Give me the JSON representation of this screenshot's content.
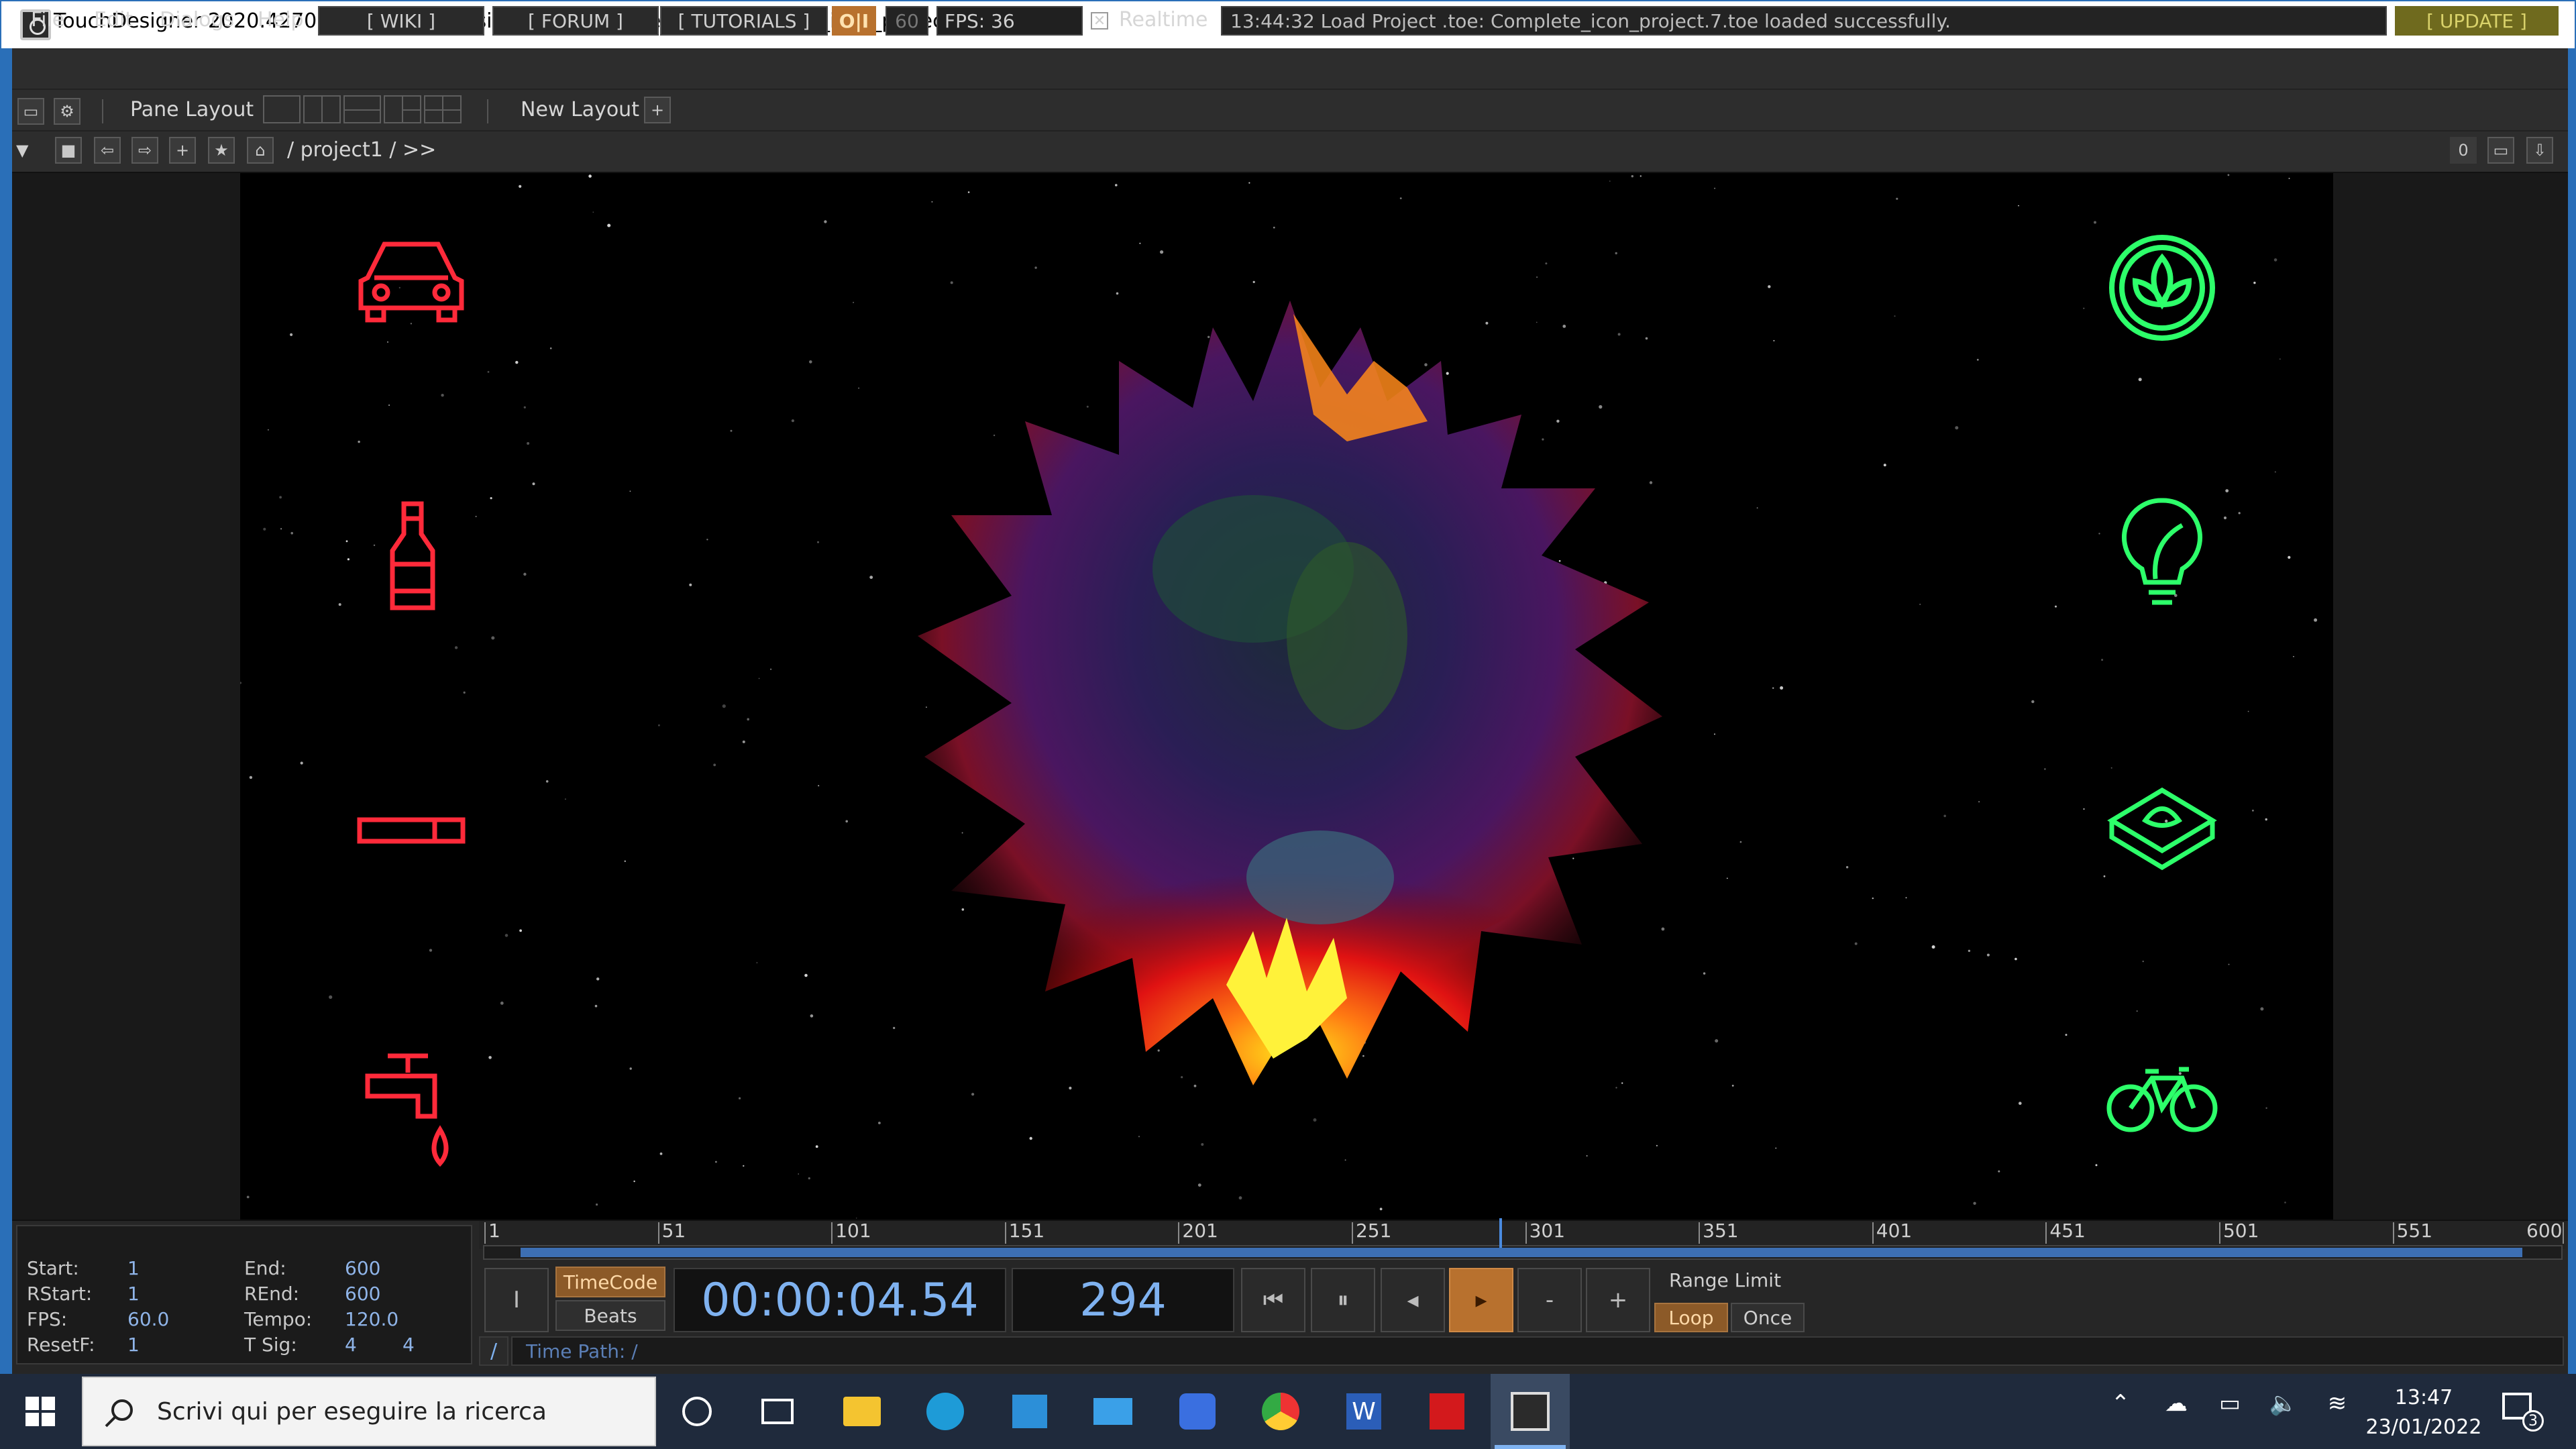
{
  "window": {
    "title": "TouchDesigner 2020.42700: C:/Users/massimo.cicognani/Desktop/Complete_icon_project.7.toe*",
    "minimize": "—",
    "maximize": "☐",
    "close": "✕"
  },
  "menubar": {
    "items": [
      "File",
      "Edit",
      "Dialogs",
      "Help"
    ],
    "wiki": "[ WIKI ]",
    "forum": "[ FORUM ]",
    "tutorials": "[ TUTORIALS ]",
    "oi": "O|I",
    "fps_cap": "60",
    "fps": "FPS:  36",
    "realtime_label": "Realtime",
    "realtime_checked": true,
    "status_message": "13:44:32 Load Project .toe: Complete_icon_project.7.toe loaded successfully.",
    "update": "[ UPDATE ]"
  },
  "panebar": {
    "pane_layout": "Pane Layout",
    "new_layout": "New Layout",
    "add": "+"
  },
  "pathbar": {
    "path": "/ project1 / >>",
    "pane_index": "0"
  },
  "viewer": {
    "left_icons": [
      "car-icon",
      "bottle-icon",
      "cigarette-icon",
      "faucet-icon"
    ],
    "right_icons": [
      "eco-leaf-icon",
      "eco-bulb-icon",
      "plant-plate-icon",
      "bicycle-icon"
    ],
    "left_color": "#ff2a3a",
    "right_color": "#2dff6a"
  },
  "timeline_info": {
    "start_label": "Start:",
    "start": "1",
    "end_label": "End:",
    "end": "600",
    "rstart_label": "RStart:",
    "rstart": "1",
    "rend_label": "REnd:",
    "rend": "600",
    "fps_label": "FPS:",
    "fps": "60.0",
    "tempo_label": "Tempo:",
    "tempo": "120.0",
    "resetf_label": "ResetF:",
    "resetf": "1",
    "tsig_label": "T Sig:",
    "tsig_a": "4",
    "tsig_b": "4"
  },
  "ruler": {
    "ticks": [
      "1",
      "51",
      "101",
      "151",
      "201",
      "251",
      "301",
      "351",
      "401",
      "451",
      "501",
      "551",
      "600"
    ],
    "current_frame": 294,
    "range": [
      1,
      600
    ]
  },
  "transport": {
    "timecode_label": "TimeCode",
    "beats_label": "Beats",
    "timecode": "00:00:04.54",
    "frame": "294",
    "range_limit": "Range Limit",
    "loop": "Loop",
    "once": "Once",
    "minus": "-",
    "plus": "+",
    "time_path": "Time Path: /",
    "slash": "/"
  },
  "taskbar": {
    "search_placeholder": "Scrivi qui per eseguire la ricerca",
    "time": "13:47",
    "date": "23/01/2022",
    "notifications": "3"
  },
  "colors": {
    "accent_orange": "#b8712e",
    "timecode_blue": "#7fb2f0",
    "frame_blue": "#2a6fb8"
  }
}
